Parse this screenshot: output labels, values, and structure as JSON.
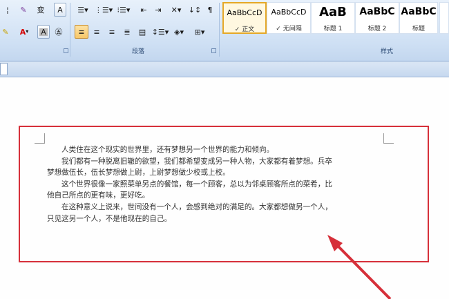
{
  "ribbon": {
    "groups": {
      "paragraph_label": "段落",
      "styles_label": "样式"
    },
    "font_buttons": {
      "row1": [
        "A",
        "A",
        "A"
      ],
      "row2": [
        "A",
        "A"
      ]
    },
    "styles": [
      {
        "sample": "AaBbCcD",
        "name": "正文",
        "selected": true
      },
      {
        "sample": "AaBbCcD",
        "name": "无间隔",
        "selected": false
      },
      {
        "sample": "AaB",
        "name": "标题 1",
        "selected": false
      },
      {
        "sample": "AaBbC",
        "name": "标题 2",
        "selected": false
      },
      {
        "sample": "AaBbC",
        "name": "标题",
        "selected": false
      }
    ]
  },
  "document": {
    "lines": [
      "人类住在这个现实的世界里，还有梦想另一个世界的能力和倾向。",
      "我们都有一种脱离旧辙的欲望，我们都希望变成另一种人物，大家都有着梦想。兵卒",
      "梦想做伍长，伍长梦想做上尉，上尉梦想做少校或上校。",
      "这个世界很像一家照菜单另点的餐馆，每一个顾客，总以为邻桌顾客所点的菜肴，比",
      "他自己所点的更有味，更好吃。",
      "在这种意义上说来，世间没有一个人，会感到绝对的满足的。大家都想做另一个人，",
      "只见这另一个人，不是他现在的自己。"
    ],
    "indented": [
      true,
      true,
      false,
      true,
      false,
      true,
      false
    ]
  },
  "annotation": {
    "box_color": "#d6303a",
    "arrow_color": "#d6303a"
  }
}
